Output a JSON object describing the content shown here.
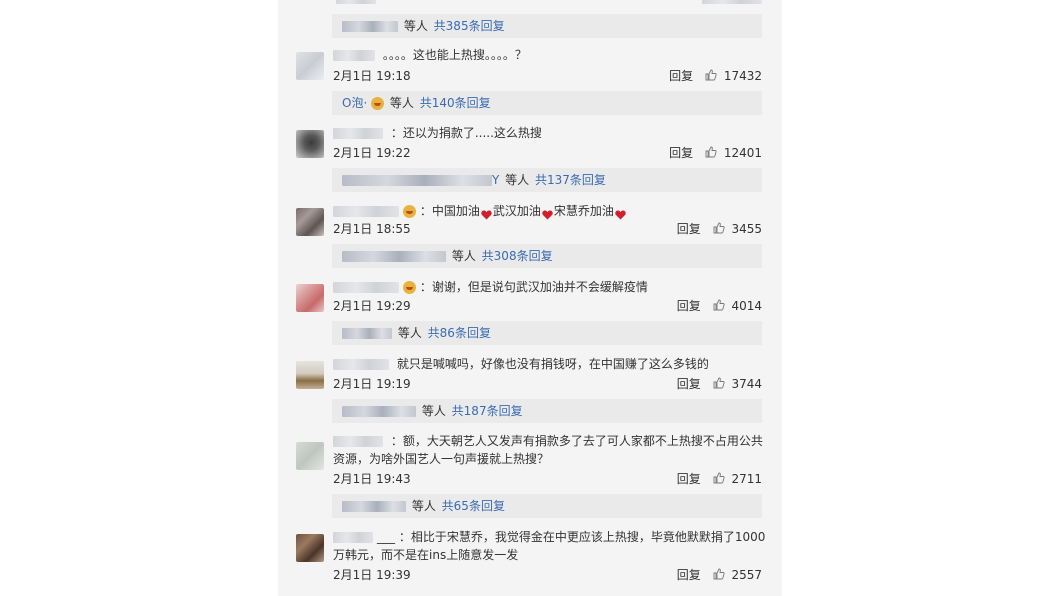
{
  "reply_bars": [
    {
      "etc": "等人",
      "count": "共385条回复"
    },
    {
      "name": "O泡·",
      "etc": "等人",
      "count": "共140条回复"
    },
    {
      "name_suffix": "Y",
      "etc": "等人",
      "count": "共137条回复"
    },
    {
      "etc": "等人",
      "count": "共308条回复"
    },
    {
      "etc": "等人",
      "count": "共86条回复"
    },
    {
      "etc": "等人",
      "count": "共187条回复"
    },
    {
      "etc": "等人",
      "count": "共65条回复"
    }
  ],
  "comments": [
    {
      "text": "。。。。这也能上热搜。。。。？",
      "time": "2月1日 19:18",
      "reply": "回复",
      "likes": "17432"
    },
    {
      "text": "：还以为捐款了.....这么热搜",
      "time": "2月1日 19:22",
      "reply": "回复",
      "likes": "12401"
    },
    {
      "t1": "：中国加油",
      "t2": "武汉加油",
      "t3": "宋慧乔加油",
      "time": "2月1日 18:55",
      "reply": "回复",
      "likes": "3455"
    },
    {
      "text": "：谢谢，但是说句武汉加油并不会缓解疫情",
      "time": "2月1日 19:29",
      "reply": "回复",
      "likes": "4014"
    },
    {
      "text": "就只是喊喊吗，好像也没有捐钱呀，在中国赚了这么多钱的",
      "time": "2月1日 19:19",
      "reply": "回复",
      "likes": "3744"
    },
    {
      "text": "：额，大天朝艺人又发声有捐款多了去了可人家都不上热搜不占用公共资源，为啥外国艺人一句声援就上热搜？",
      "time": "2月1日 19:43",
      "reply": "回复",
      "likes": "2711"
    },
    {
      "name_visible": "___",
      "text": "：相比于宋慧乔，我觉得金在中更应该上热搜，毕竟他默默捐了1000万韩元，而不是在ins上随意发一发",
      "time": "2月1日 19:39",
      "reply": "回复",
      "likes": "2557"
    }
  ],
  "icons": {
    "like": "thumbs-up-icon",
    "heart": "red-heart-icon",
    "emoji": "smiley-emoji-icon"
  },
  "colors": {
    "link": "#3a6bb0",
    "heart": "#d0202e",
    "panel": "#f4f4f4",
    "reply_bar": "#eaeaea"
  }
}
